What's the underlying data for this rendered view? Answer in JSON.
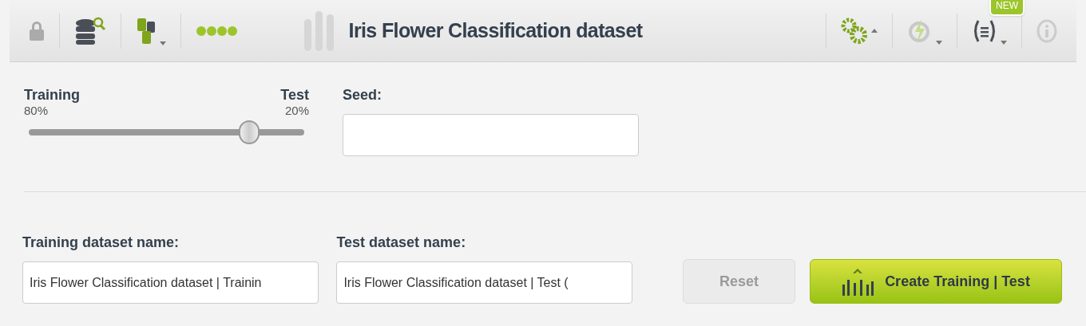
{
  "toolbar": {
    "title": "Iris Flower Classification dataset",
    "new_badge": "NEW"
  },
  "split": {
    "left_label": "Training",
    "left_value": "80%",
    "right_label": "Test",
    "right_value": "20%",
    "level": 0.8
  },
  "seed": {
    "label": "Seed:"
  },
  "training_name": {
    "label": "Training dataset name:",
    "value": "Iris Flower Classification dataset | Trainin"
  },
  "test_name": {
    "label": "Test dataset name:",
    "value": "Iris Flower Classification dataset | Test ("
  },
  "buttons": [
    {
      "kind": "reset",
      "label": "Reset",
      "disabled": true
    },
    {
      "kind": "create",
      "label": "Create Training | Test",
      "disabled": false
    }
  ]
}
